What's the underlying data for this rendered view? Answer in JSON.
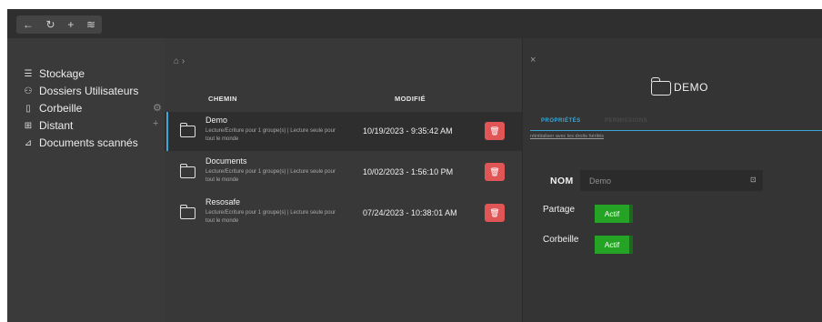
{
  "toolbar": {
    "back_icon": "←",
    "refresh_icon": "↻",
    "add_icon": "+",
    "settings_icon": "≋"
  },
  "sidebar": {
    "items": [
      {
        "label": "Stockage",
        "icon": "storage-icon",
        "glyph": "☰"
      },
      {
        "label": "Dossiers Utilisateurs",
        "icon": "users-icon",
        "glyph": "⚇"
      },
      {
        "label": "Corbeille",
        "icon": "trash-icon",
        "glyph": "▯"
      },
      {
        "label": "Distant",
        "icon": "network-icon",
        "glyph": "⊞"
      },
      {
        "label": "Documents scannés",
        "icon": "scanner-icon",
        "glyph": "⊿"
      }
    ],
    "corbeille_settings_glyph": "⚙",
    "distant_add_glyph": "+"
  },
  "list": {
    "breadcrumb": "⌂ ›",
    "headers": {
      "path": "CHEMIN",
      "modified": "MODIFIÉ"
    },
    "rows": [
      {
        "name": "Demo",
        "permissions": "Lecture/Ecriture pour 1 groupe(s) | Lecture seule pour tout le monde",
        "modified": "10/19/2023 - 9:35:42 AM"
      },
      {
        "name": "Documents",
        "permissions": "Lecture/Ecriture pour 1 groupe(s) | Lecture seule pour tout le monde",
        "modified": "10/02/2023 - 1:56:10 PM"
      },
      {
        "name": "Resosafe",
        "permissions": "Lecture/Ecriture pour 1 groupe(s) | Lecture seule pour tout le monde",
        "modified": "07/24/2023 - 10:38:01 AM"
      }
    ],
    "trash_glyph": "🗑"
  },
  "details": {
    "close_glyph": "×",
    "title": "DEMO",
    "tabs": {
      "properties": "PROPRIÉTÉS",
      "permissions": "PERMISSIONS"
    },
    "reset_link": "réinitialiser avec les droits hérités",
    "name_label": "NOM",
    "name_value": "Demo",
    "save_glyph": "⊡",
    "share_label": "Partage",
    "share_state": "Actif",
    "trash_label": "Corbeille",
    "trash_state": "Actif"
  },
  "colors": {
    "accent": "#3aa7d9",
    "danger": "#e05656",
    "toggle_on": "#24a324"
  }
}
